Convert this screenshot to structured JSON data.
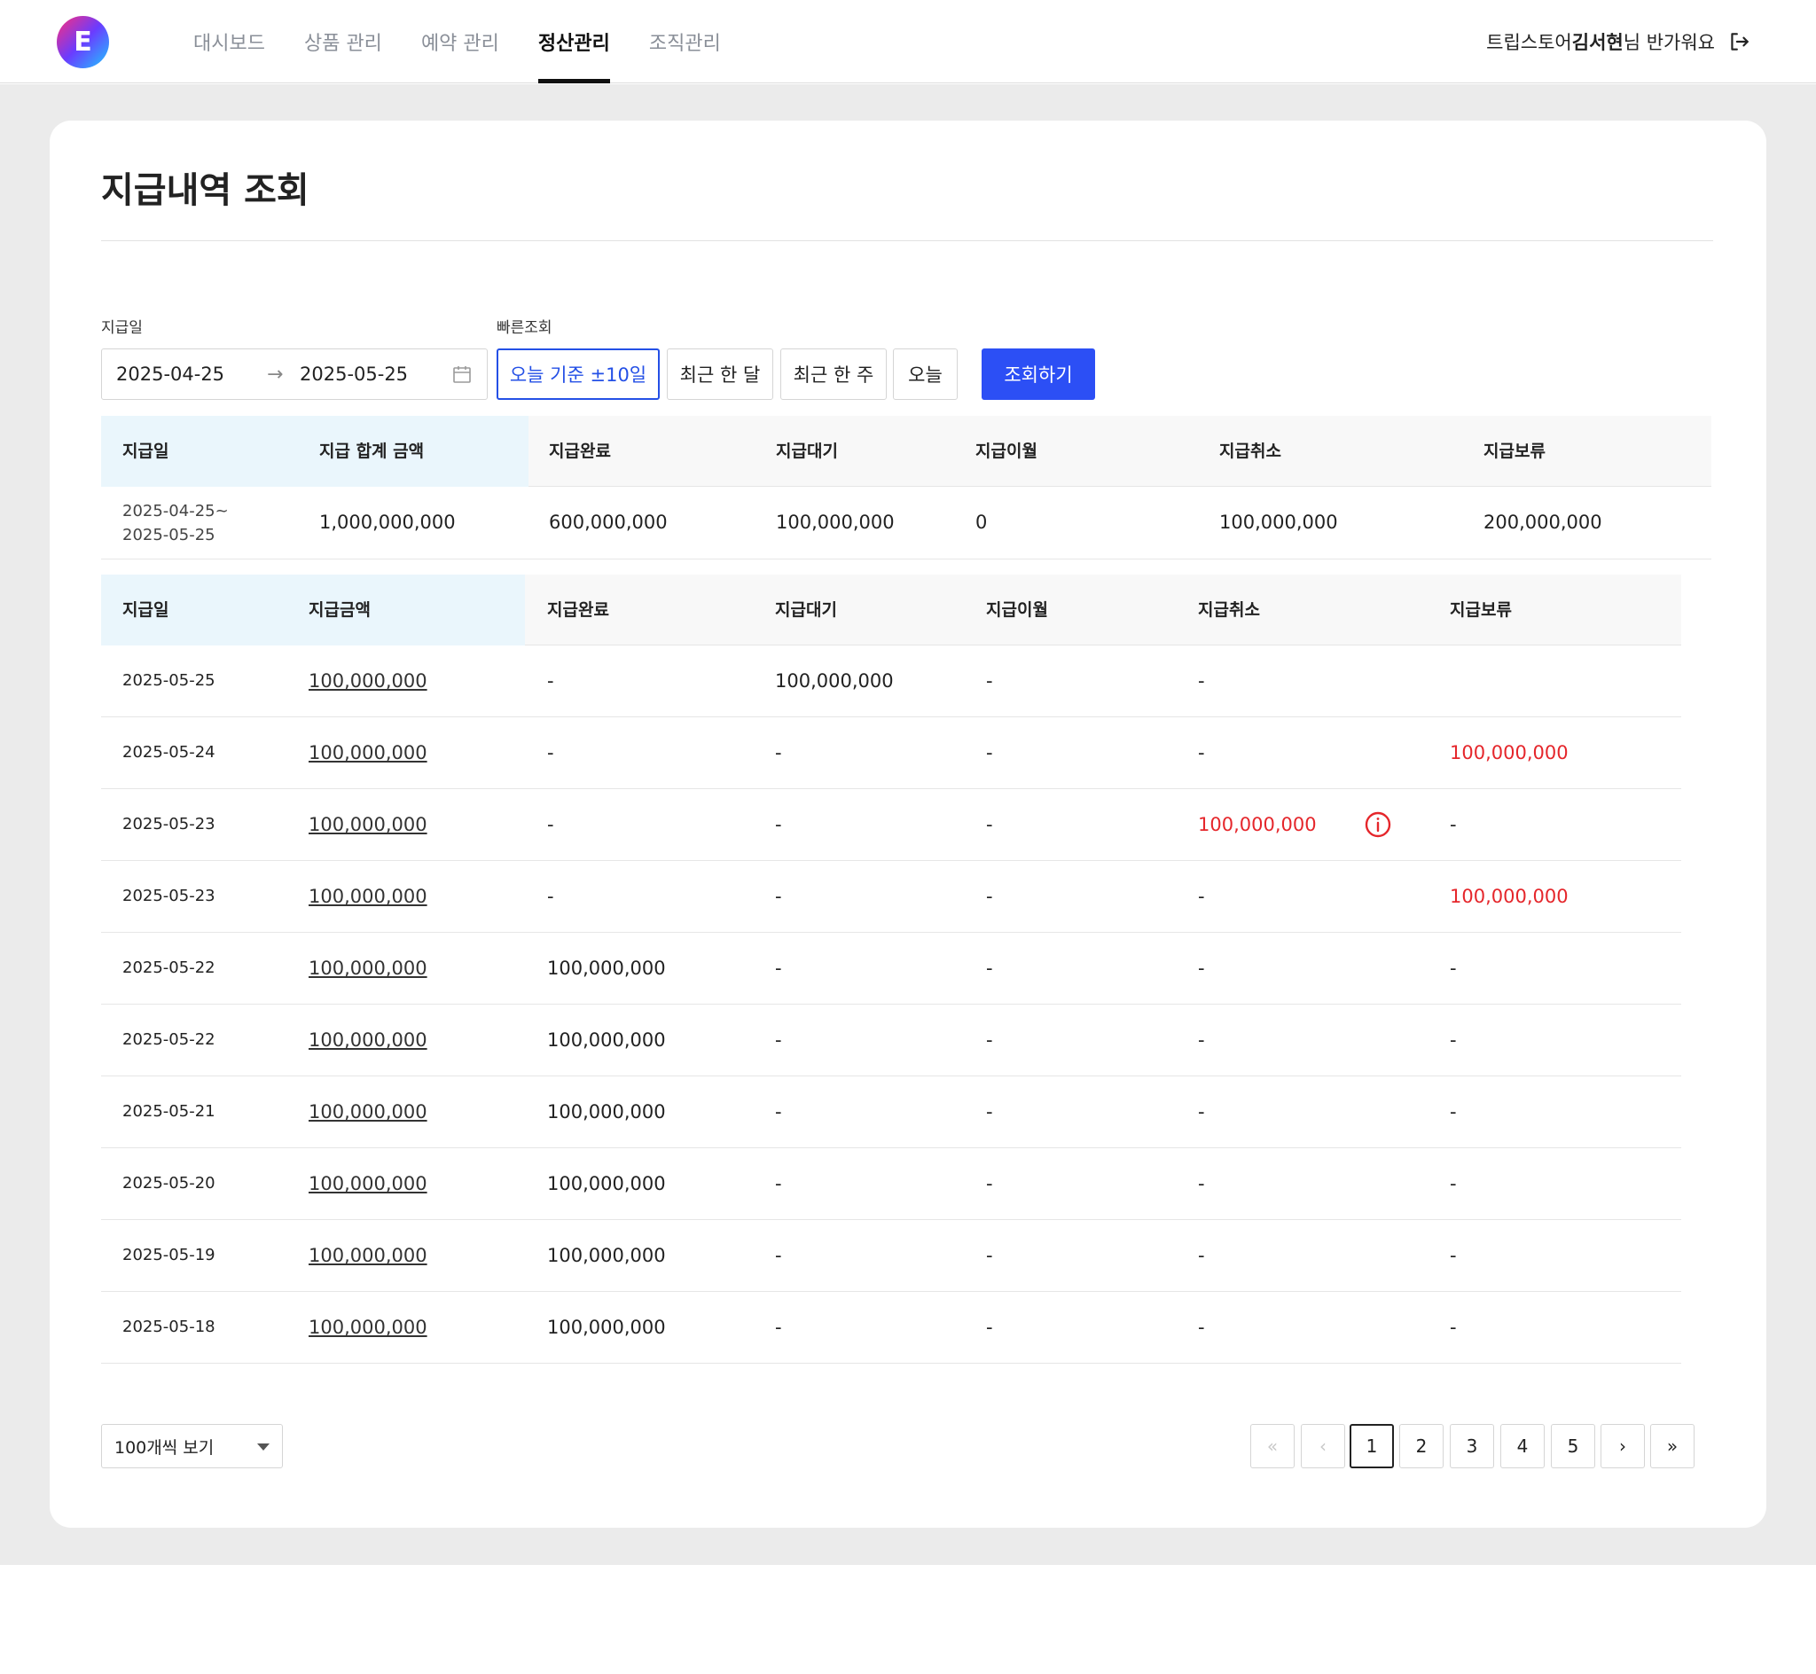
{
  "header": {
    "logo_letter": "E",
    "nav": [
      "대시보드",
      "상품 관리",
      "예약 관리",
      "정산관리",
      "조직관리"
    ],
    "active_nav": "정산관리",
    "user_prefix": "트립스토어",
    "user_name": "김서현",
    "user_suffix": "님 반가워요"
  },
  "page": {
    "title": "지급내역 조회"
  },
  "filters": {
    "date_label": "지급일",
    "quick_label": "빠른조회",
    "start_date": "2025-04-25",
    "end_date": "2025-05-25",
    "quick_buttons": [
      "오늘 기준 ±10일",
      "최근 한 달",
      "최근 한 주",
      "오늘"
    ],
    "active_quick": "오늘 기준 ±10일",
    "search_label": "조회하기"
  },
  "summary": {
    "headers": [
      "지급일",
      "지급 합계 금액",
      "지급완료",
      "지급대기",
      "지급이월",
      "지급취소",
      "지급보류"
    ],
    "date_line1": "2025-04-25~",
    "date_line2": "2025-05-25",
    "total": "1,000,000,000",
    "completed": "600,000,000",
    "pending": "100,000,000",
    "carried": "0",
    "cancelled": "100,000,000",
    "held": "200,000,000"
  },
  "detail": {
    "headers": [
      "지급일",
      "지급금액",
      "지급완료",
      "지급대기",
      "지급이월",
      "지급취소",
      "지급보류"
    ],
    "rows": [
      {
        "date": "2025-05-25",
        "amount": "100,000,000",
        "completed": "-",
        "pending": "100,000,000",
        "carried": "-",
        "cancelled": "-",
        "held": ""
      },
      {
        "date": "2025-05-24",
        "amount": "100,000,000",
        "completed": "-",
        "pending": "-",
        "carried": "-",
        "cancelled": "-",
        "held": "100,000,000"
      },
      {
        "date": "2025-05-23",
        "amount": "100,000,000",
        "completed": "-",
        "pending": "-",
        "carried": "-",
        "cancelled": "100,000,000",
        "held": "-"
      },
      {
        "date": "2025-05-23",
        "amount": "100,000,000",
        "completed": "-",
        "pending": "-",
        "carried": "-",
        "cancelled": "-",
        "held": "100,000,000"
      },
      {
        "date": "2025-05-22",
        "amount": "100,000,000",
        "completed": "100,000,000",
        "pending": "-",
        "carried": "-",
        "cancelled": "-",
        "held": "-"
      },
      {
        "date": "2025-05-22",
        "amount": "100,000,000",
        "completed": "100,000,000",
        "pending": "-",
        "carried": "-",
        "cancelled": "-",
        "held": "-"
      },
      {
        "date": "2025-05-21",
        "amount": "100,000,000",
        "completed": "100,000,000",
        "pending": "-",
        "carried": "-",
        "cancelled": "-",
        "held": "-"
      },
      {
        "date": "2025-05-20",
        "amount": "100,000,000",
        "completed": "100,000,000",
        "pending": "-",
        "carried": "-",
        "cancelled": "-",
        "held": "-"
      },
      {
        "date": "2025-05-19",
        "amount": "100,000,000",
        "completed": "100,000,000",
        "pending": "-",
        "carried": "-",
        "cancelled": "-",
        "held": "-"
      },
      {
        "date": "2025-05-18",
        "amount": "100,000,000",
        "completed": "100,000,000",
        "pending": "-",
        "carried": "-",
        "cancelled": "-",
        "held": "-"
      }
    ]
  },
  "footer": {
    "per_page": "100개씩 보기",
    "pages": [
      "1",
      "2",
      "3",
      "4",
      "5"
    ],
    "current_page": "1",
    "first_glyph": "«",
    "prev_glyph": "‹",
    "next_glyph": "›",
    "last_glyph": "»"
  },
  "colors": {
    "accent": "#2c4ff5",
    "warning_red": "#e5262b",
    "header_highlight": "#eaf6fc"
  },
  "icons": [
    "logout-icon",
    "arrow-right-icon",
    "calendar-icon",
    "info-icon",
    "caret-down-icon"
  ]
}
